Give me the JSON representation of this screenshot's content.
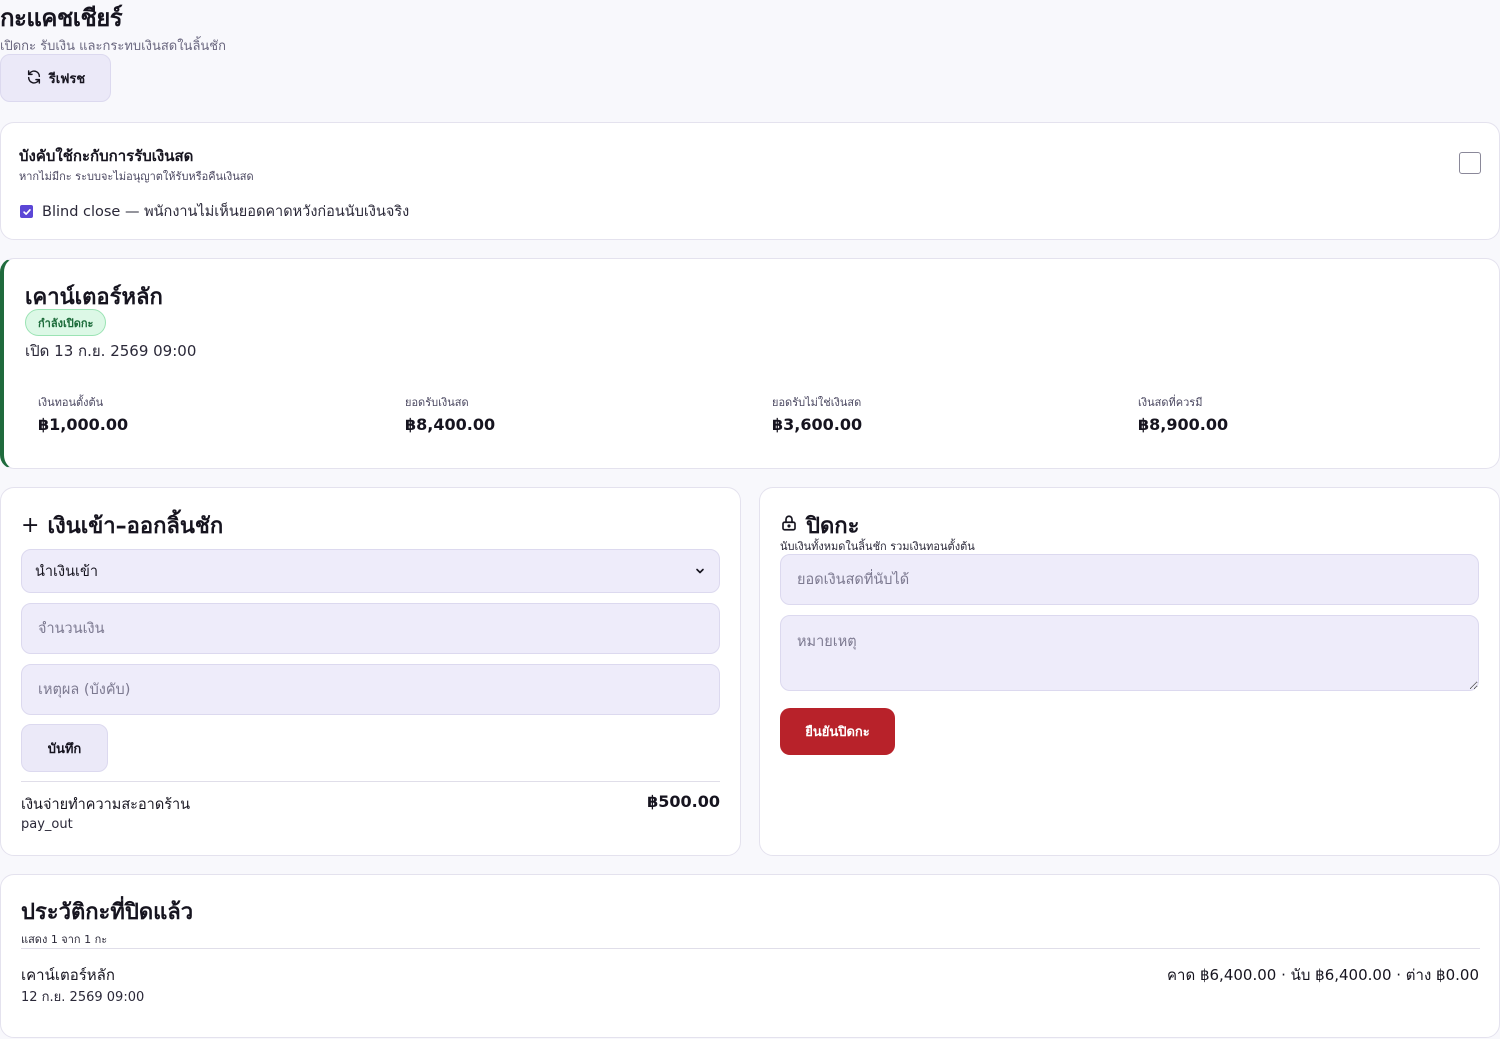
{
  "header": {
    "title": "กะแคชเชียร์",
    "subtitle": "เปิดกะ รับเงิน และกระทบเงินสดในลิ้นชัก",
    "refresh_label": "รีเฟรช"
  },
  "settings": {
    "title": "บังคับใช้กะกับการรับเงินสด",
    "description": "หากไม่มีกะ ระบบจะไม่อนุญาตให้รับหรือคืนเงินสด",
    "enforce_checked": false,
    "blind_close_label": "Blind close — พนักงานไม่เห็นยอดคาดหวังก่อนนับเงินจริง",
    "blind_close_checked": true,
    "accent_color": "#5b46d6"
  },
  "shift": {
    "counter_name": "เคาน์เตอร์หลัก",
    "status": "กำลังเปิดกะ",
    "opened_at": "เปิด 13 ก.ย. 2569 09:00",
    "status_color": "#1f6b3d",
    "stats": [
      {
        "label": "เงินทอนตั้งต้น",
        "value": "฿1,000.00"
      },
      {
        "label": "ยอดรับเงินสด",
        "value": "฿8,400.00"
      },
      {
        "label": "ยอดรับไม่ใช่เงินสด",
        "value": "฿3,600.00"
      },
      {
        "label": "เงินสดที่ควรมี",
        "value": "฿8,900.00"
      }
    ]
  },
  "cash_movement": {
    "icon": "plus-icon",
    "title": "เงินเข้า–ออกลิ้นชัก",
    "type_selected": "นำเงินเข้า",
    "amount_placeholder": "จำนวนเงิน",
    "reason_placeholder": "เหตุผล (บังคับ)",
    "save_label": "บันทึก",
    "transactions": [
      {
        "description": "เงินจ่ายทำความสะอาดร้าน",
        "type": "pay_out",
        "amount": "฿500.00"
      }
    ]
  },
  "close_shift": {
    "icon": "lock-icon",
    "title": "ปิดกะ",
    "description": "นับเงินทั้งหมดในลิ้นชัก รวมเงินทอนตั้งต้น",
    "counted_placeholder": "ยอดเงินสดที่นับได้",
    "note_placeholder": "หมายเหตุ",
    "confirm_label": "ยืนยันปิดกะ",
    "confirm_color": "#b8222a"
  },
  "history": {
    "title": "ประวัติกะที่ปิดแล้ว",
    "count_text": "แสดง 1 จาก 1 กะ",
    "items": [
      {
        "counter": "เคาน์เตอร์หลัก",
        "date": "12 ก.ย. 2569 09:00",
        "summary": "คาด ฿6,400.00 · นับ ฿6,400.00 · ต่าง ฿0.00"
      }
    ]
  }
}
